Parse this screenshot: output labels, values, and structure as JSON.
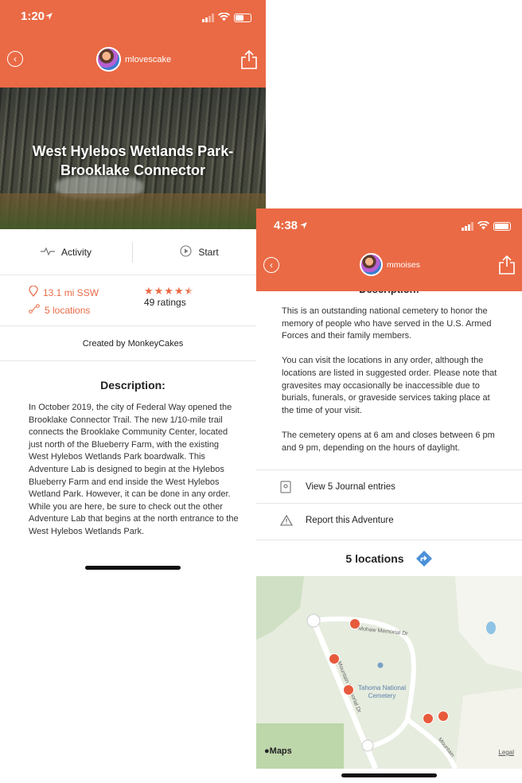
{
  "left": {
    "status": {
      "time": "1:20"
    },
    "header": {
      "username": "mlovescake"
    },
    "hero": {
      "title_line1": "West Hylebos Wetlands Park-",
      "title_line2": "Brooklake Connector"
    },
    "tabs": {
      "activity": "Activity",
      "start": "Start"
    },
    "stats": {
      "distance": "13.1 mi SSW",
      "locations": "5 locations",
      "rating_value": 4.5,
      "stars": "★★★★★",
      "ratings": "49 ratings"
    },
    "creator": "Created by MonkeyCakes",
    "description_title": "Description:",
    "description": "In October 2019, the city of Federal Way opened the Brooklake Connector Trail. The new 1/10-mile trail connects the Brooklake Community Center, located just north of the Blueberry Farm, with the existing West Hylebos Wetlands Park boardwalk. This Adventure Lab is designed to begin at the Hylebos Blueberry Farm and end inside the West Hylebos Wetland Park.  However, it can be done in any order.\nWhile you are here, be sure to check out the other Adventure Lab that begins at the north entrance to the West Hylebos Wetlands Park."
  },
  "right": {
    "status": {
      "time": "4:38"
    },
    "header": {
      "username": "mmoises"
    },
    "description_title": "Description:",
    "paragraphs": [
      "This is an outstanding national cemetery to honor the memory of people who have served in the U.S. Armed Forces and their family members.",
      "You can visit the locations in any order, although the locations are listed in suggested order. Please note that gravesites may occasionally be inaccessible due to burials, funerals, or graveside services taking place at the time of your visit.",
      "The cemetery opens at 6 am and closes between 6 pm and 9 pm, depending on the hours of daylight."
    ],
    "journal": "View 5 Journal entries",
    "report": "Report this Adventure",
    "locations": "5 locations",
    "map": {
      "road1": "Mohaw Memorial Dr",
      "road2": "Mountain Memorial Dr",
      "road3": "Mountain",
      "place_line1": "Tahoma National",
      "place_line2": "Cemetery",
      "maps_label": "Maps",
      "legal": "Legal"
    }
  },
  "colors": {
    "accent": "#ea6a45",
    "direction": "#4a90d9"
  }
}
